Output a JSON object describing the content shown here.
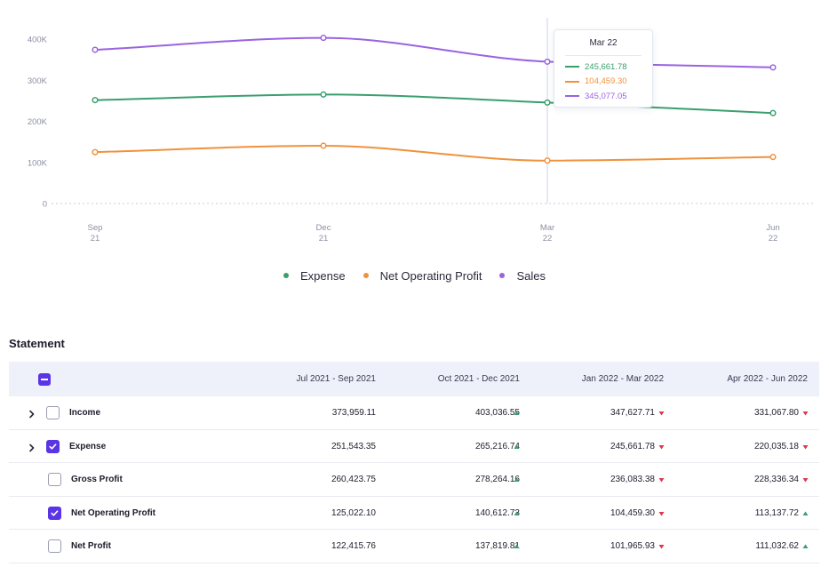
{
  "chart_data": {
    "type": "line",
    "categories": [
      "Sep 21",
      "Dec 21",
      "Mar 22",
      "Jun 22"
    ],
    "x_ticks": [
      {
        "top": "Sep",
        "bottom": "21"
      },
      {
        "top": "Dec",
        "bottom": "21"
      },
      {
        "top": "Mar",
        "bottom": "22"
      },
      {
        "top": "Jun",
        "bottom": "22"
      }
    ],
    "y_ticks": [
      "0",
      "100K",
      "200K",
      "300K",
      "400K"
    ],
    "y_tick_values": [
      0,
      100000,
      200000,
      300000,
      400000
    ],
    "ylim": [
      0,
      400000
    ],
    "grid": false,
    "series": [
      {
        "name": "Expense",
        "color": "#3a9f6e",
        "values": [
          251543.35,
          265216.74,
          245661.78,
          220035.18
        ]
      },
      {
        "name": "Net Operating Profit",
        "color": "#f0923c",
        "values": [
          125022.1,
          140612.73,
          104459.3,
          113137.72
        ]
      },
      {
        "name": "Sales",
        "color": "#9a63e0",
        "values": [
          373959.11,
          403036.55,
          345077.05,
          331067.8
        ]
      }
    ],
    "hover_index": 2
  },
  "tooltip": {
    "title": "Mar 22",
    "rows": [
      {
        "value": "245,661.78",
        "color": "#3a9f6e"
      },
      {
        "value": "104,459.30",
        "color": "#f0923c"
      },
      {
        "value": "345,077.05",
        "color": "#9a63e0"
      }
    ]
  },
  "legend": [
    {
      "label": "Expense",
      "color": "#3a9f6e"
    },
    {
      "label": "Net Operating Profit",
      "color": "#f0923c"
    },
    {
      "label": "Sales",
      "color": "#9a63e0"
    }
  ],
  "statement": {
    "title": "Statement",
    "columns": [
      "Jul 2021 - Sep 2021",
      "Oct 2021 - Dec 2021",
      "Jan 2022 - Mar 2022",
      "Apr 2022 - Jun 2022"
    ],
    "rows": [
      {
        "label": "Income",
        "expandable": true,
        "checked": false,
        "values": [
          "373,959.11",
          "403,036.55",
          "347,627.71",
          "331,067.80"
        ],
        "trends": [
          "",
          "up",
          "down",
          "down"
        ]
      },
      {
        "label": "Expense",
        "expandable": true,
        "checked": true,
        "values": [
          "251,543.35",
          "265,216.74",
          "245,661.78",
          "220,035.18"
        ],
        "trends": [
          "",
          "up",
          "down",
          "down"
        ]
      },
      {
        "label": "Gross Profit",
        "expandable": false,
        "checked": false,
        "values": [
          "260,423.75",
          "278,264.16",
          "236,083.38",
          "228,336.34"
        ],
        "trends": [
          "",
          "up",
          "down",
          "down"
        ]
      },
      {
        "label": "Net Operating Profit",
        "expandable": false,
        "checked": true,
        "values": [
          "125,022.10",
          "140,612.73",
          "104,459.30",
          "113,137.72"
        ],
        "trends": [
          "",
          "up",
          "down",
          "up"
        ]
      },
      {
        "label": "Net Profit",
        "expandable": false,
        "checked": false,
        "values": [
          "122,415.76",
          "137,819.81",
          "101,965.93",
          "111,032.62"
        ],
        "trends": [
          "",
          "up",
          "down",
          "up"
        ]
      }
    ]
  },
  "colors": {
    "accent": "#5a35e6",
    "trend_up": "#3a9f6e",
    "trend_down": "#e0364b"
  }
}
